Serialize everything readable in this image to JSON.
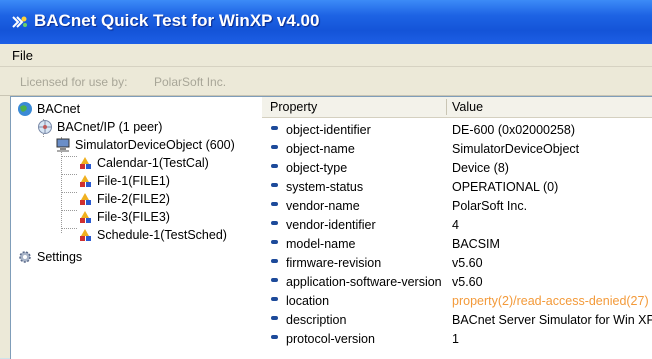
{
  "window": {
    "title": "BACnet Quick Test for WinXP v4.00"
  },
  "menu": {
    "file_label": "File"
  },
  "license": {
    "label": "Licensed for use by:",
    "value": "PolarSoft Inc."
  },
  "tree": {
    "root": "BACnet",
    "network": "BACnet/IP (1 peer)",
    "device": "SimulatorDeviceObject (600)",
    "objects": [
      "Calendar-1(TestCal)",
      "File-1(FILE1)",
      "File-2(FILE2)",
      "File-3(FILE3)",
      "Schedule-1(TestSched)"
    ],
    "settings": "Settings"
  },
  "grid": {
    "headers": {
      "property": "Property",
      "value": "Value"
    },
    "rows": [
      {
        "property": "object-identifier",
        "value": "DE-600 (0x02000258)",
        "error": false
      },
      {
        "property": "object-name",
        "value": "SimulatorDeviceObject",
        "error": false
      },
      {
        "property": "object-type",
        "value": "Device (8)",
        "error": false
      },
      {
        "property": "system-status",
        "value": "OPERATIONAL (0)",
        "error": false
      },
      {
        "property": "vendor-name",
        "value": "PolarSoft Inc.",
        "error": false
      },
      {
        "property": "vendor-identifier",
        "value": "4",
        "error": false
      },
      {
        "property": "model-name",
        "value": "BACSIM",
        "error": false
      },
      {
        "property": "firmware-revision",
        "value": "v5.60",
        "error": false
      },
      {
        "property": "application-software-version",
        "value": "v5.60",
        "error": false
      },
      {
        "property": "location",
        "value": "property(2)/read-access-denied(27)",
        "error": true
      },
      {
        "property": "description",
        "value": "BACnet Server Simulator for Win XP",
        "error": false
      },
      {
        "property": "protocol-version",
        "value": "1",
        "error": false
      }
    ]
  },
  "colors": {
    "titlebar": "#1454d8",
    "error_value": "#f39a3a",
    "bullet": "#1d4a9a"
  },
  "icons": {
    "title": "bacnet-app-icon",
    "root": "globe-icon",
    "network": "network-icon",
    "device": "computer-icon",
    "object": "object-shapes-icon",
    "settings": "gear-icon"
  }
}
